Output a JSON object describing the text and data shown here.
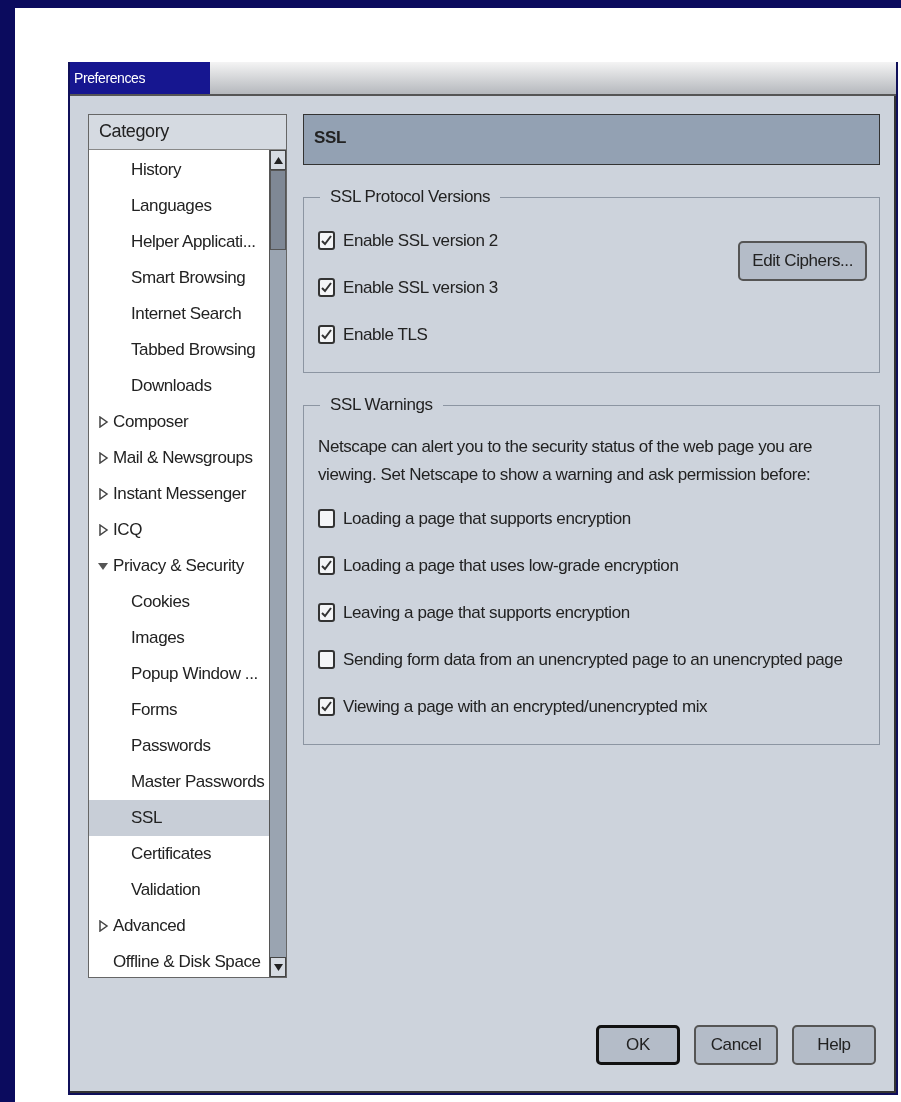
{
  "window": {
    "title": "Preferences"
  },
  "tree": {
    "header": "Category",
    "items": [
      {
        "kind": "continuation",
        "children": [
          {
            "label": "History",
            "selected": false
          },
          {
            "label": "Languages",
            "selected": false
          },
          {
            "label": "Helper Applicati...",
            "selected": false
          },
          {
            "label": "Smart Browsing",
            "selected": false
          },
          {
            "label": "Internet Search",
            "selected": false
          },
          {
            "label": "Tabbed Browsing",
            "selected": false
          },
          {
            "label": "Downloads",
            "selected": false
          }
        ]
      },
      {
        "kind": "group",
        "label": "Composer",
        "expanded": false,
        "selected": false
      },
      {
        "kind": "group",
        "label": "Mail & Newsgroups",
        "expanded": false,
        "selected": false
      },
      {
        "kind": "group",
        "label": "Instant Messenger",
        "expanded": false,
        "selected": false
      },
      {
        "kind": "group",
        "label": "ICQ",
        "expanded": false,
        "selected": false
      },
      {
        "kind": "group",
        "label": "Privacy & Security",
        "expanded": true,
        "selected": false,
        "children": [
          {
            "label": "Cookies",
            "selected": false
          },
          {
            "label": "Images",
            "selected": false
          },
          {
            "label": "Popup Window ...",
            "selected": false
          },
          {
            "label": "Forms",
            "selected": false
          },
          {
            "label": "Passwords",
            "selected": false
          },
          {
            "label": "Master Passwords",
            "selected": false
          },
          {
            "label": "SSL",
            "selected": true
          },
          {
            "label": "Certificates",
            "selected": false
          },
          {
            "label": "Validation",
            "selected": false
          }
        ]
      },
      {
        "kind": "group",
        "label": "Advanced",
        "expanded": false,
        "selected": false
      },
      {
        "kind": "leaf",
        "label": "Offline & Disk Space",
        "selected": false
      }
    ]
  },
  "panel": {
    "title": "SSL",
    "protocol_group": {
      "legend": "SSL Protocol Versions",
      "options": [
        {
          "label": "Enable SSL version 2",
          "checked": true
        },
        {
          "label": "Enable SSL version 3",
          "checked": true
        },
        {
          "label": "Enable TLS",
          "checked": true
        }
      ],
      "button": "Edit Ciphers..."
    },
    "warnings_group": {
      "legend": "SSL Warnings",
      "description": "Netscape can alert you to the security status of the web page you are viewing. Set Netscape to show a warning and ask permission before:",
      "options": [
        {
          "label": "Loading a page that supports encryption",
          "checked": false
        },
        {
          "label": "Loading a page that uses low-grade encryption",
          "checked": true
        },
        {
          "label": "Leaving a page that supports encryption",
          "checked": true
        },
        {
          "label": "Sending form data from an unencrypted page to an unencrypted page",
          "checked": false
        },
        {
          "label": "Viewing a page with an encrypted/unencrypted mix",
          "checked": true
        }
      ]
    }
  },
  "buttons": [
    {
      "label": "OK",
      "default": true
    },
    {
      "label": "Cancel",
      "default": false
    },
    {
      "label": "Help",
      "default": false
    }
  ]
}
